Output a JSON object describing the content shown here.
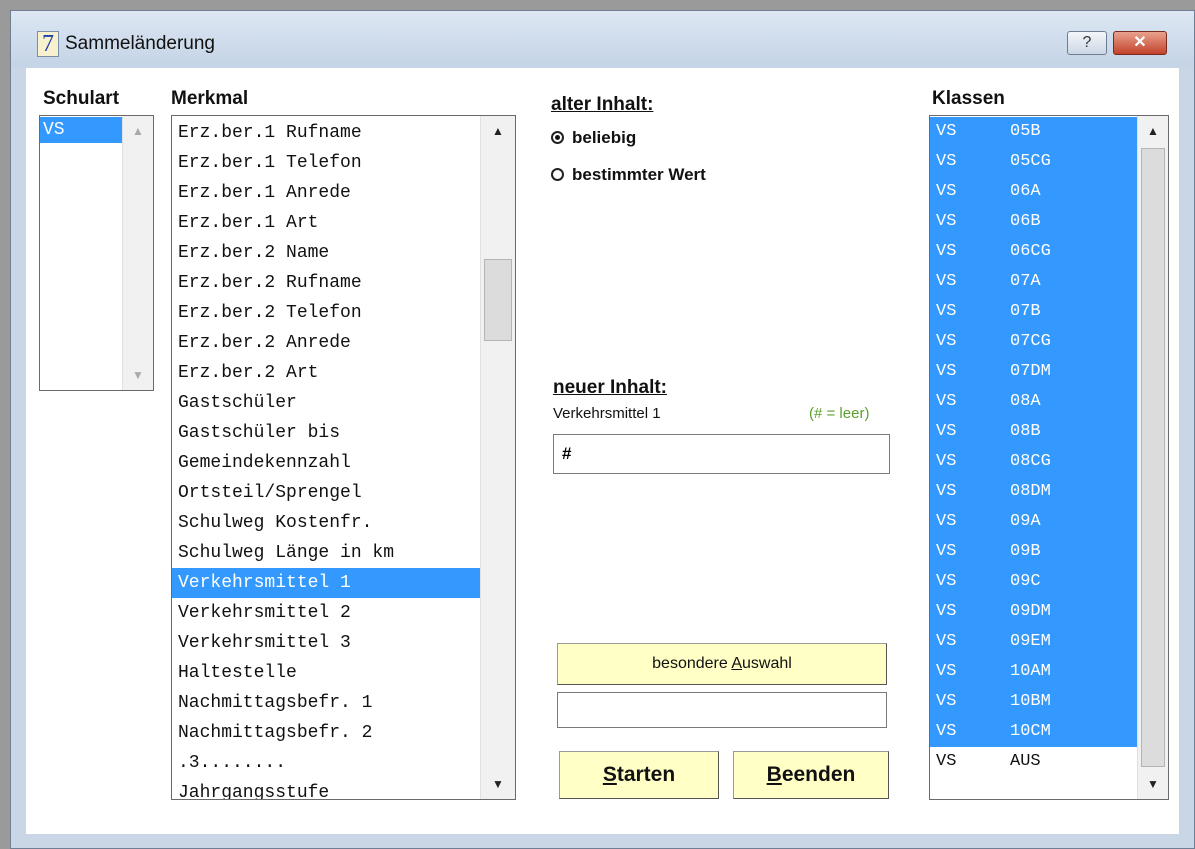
{
  "window": {
    "app_icon_glyph": "7",
    "title": "Sammeländerung",
    "help_glyph": "?",
    "close_glyph": "✕"
  },
  "schulart": {
    "header": "Schulart",
    "items": [
      "VS"
    ],
    "selected_index": 0
  },
  "merkmal": {
    "header": "Merkmal",
    "items": [
      "Erz.ber.1 Rufname",
      "Erz.ber.1 Telefon",
      "Erz.ber.1 Anrede",
      "Erz.ber.1 Art",
      "Erz.ber.2 Name",
      "Erz.ber.2 Rufname",
      "Erz.ber.2 Telefon",
      "Erz.ber.2 Anrede",
      "Erz.ber.2 Art",
      "Gastschüler",
      "Gastschüler bis",
      "Gemeindekennzahl",
      "Ortsteil/Sprengel",
      "Schulweg Kostenfr.",
      "Schulweg Länge in km",
      "Verkehrsmittel 1",
      "Verkehrsmittel 2",
      "Verkehrsmittel 3",
      "Haltestelle",
      "Nachmittagsbefr. 1",
      "Nachmittagsbefr. 2",
      ".3........",
      "Jahrgangsstufe"
    ],
    "selected_index": 15,
    "scroll_position_fraction": 0.32
  },
  "alter_inhalt": {
    "header": "alter Inhalt:",
    "options": [
      "beliebig",
      "bestimmter Wert"
    ],
    "selected_index": 0
  },
  "neuer_inhalt": {
    "header": "neuer Inhalt:",
    "field_label": "Verkehrsmittel 1",
    "hint": "(# = leer)",
    "hint_color": "#5aa02c",
    "value": "#"
  },
  "besondere_auswahl": {
    "label_before": "besondere ",
    "label_accel": "A",
    "label_after": "uswahl",
    "result_value": ""
  },
  "buttons": {
    "start": {
      "accel": "S",
      "rest": "tarten"
    },
    "end": {
      "accel": "B",
      "rest": "eenden"
    }
  },
  "klassen": {
    "header": "Klassen",
    "items": [
      {
        "schulart": "VS",
        "klasse": "05B",
        "selected": true
      },
      {
        "schulart": "VS",
        "klasse": "05CG",
        "selected": true
      },
      {
        "schulart": "VS",
        "klasse": "06A",
        "selected": true
      },
      {
        "schulart": "VS",
        "klasse": "06B",
        "selected": true
      },
      {
        "schulart": "VS",
        "klasse": "06CG",
        "selected": true
      },
      {
        "schulart": "VS",
        "klasse": "07A",
        "selected": true
      },
      {
        "schulart": "VS",
        "klasse": "07B",
        "selected": true
      },
      {
        "schulart": "VS",
        "klasse": "07CG",
        "selected": true
      },
      {
        "schulart": "VS",
        "klasse": "07DM",
        "selected": true
      },
      {
        "schulart": "VS",
        "klasse": "08A",
        "selected": true
      },
      {
        "schulart": "VS",
        "klasse": "08B",
        "selected": true
      },
      {
        "schulart": "VS",
        "klasse": "08CG",
        "selected": true
      },
      {
        "schulart": "VS",
        "klasse": "08DM",
        "selected": true
      },
      {
        "schulart": "VS",
        "klasse": "09A",
        "selected": true
      },
      {
        "schulart": "VS",
        "klasse": "09B",
        "selected": true
      },
      {
        "schulart": "VS",
        "klasse": "09C",
        "selected": true
      },
      {
        "schulart": "VS",
        "klasse": "09DM",
        "selected": true
      },
      {
        "schulart": "VS",
        "klasse": "09EM",
        "selected": true
      },
      {
        "schulart": "VS",
        "klasse": "10AM",
        "selected": true
      },
      {
        "schulart": "VS",
        "klasse": "10BM",
        "selected": true
      },
      {
        "schulart": "VS",
        "klasse": "10CM",
        "selected": true
      },
      {
        "schulart": "VS",
        "klasse": "AUS",
        "selected": false
      }
    ]
  },
  "icons": {
    "scroll_up": "▲",
    "scroll_down": "▼"
  }
}
